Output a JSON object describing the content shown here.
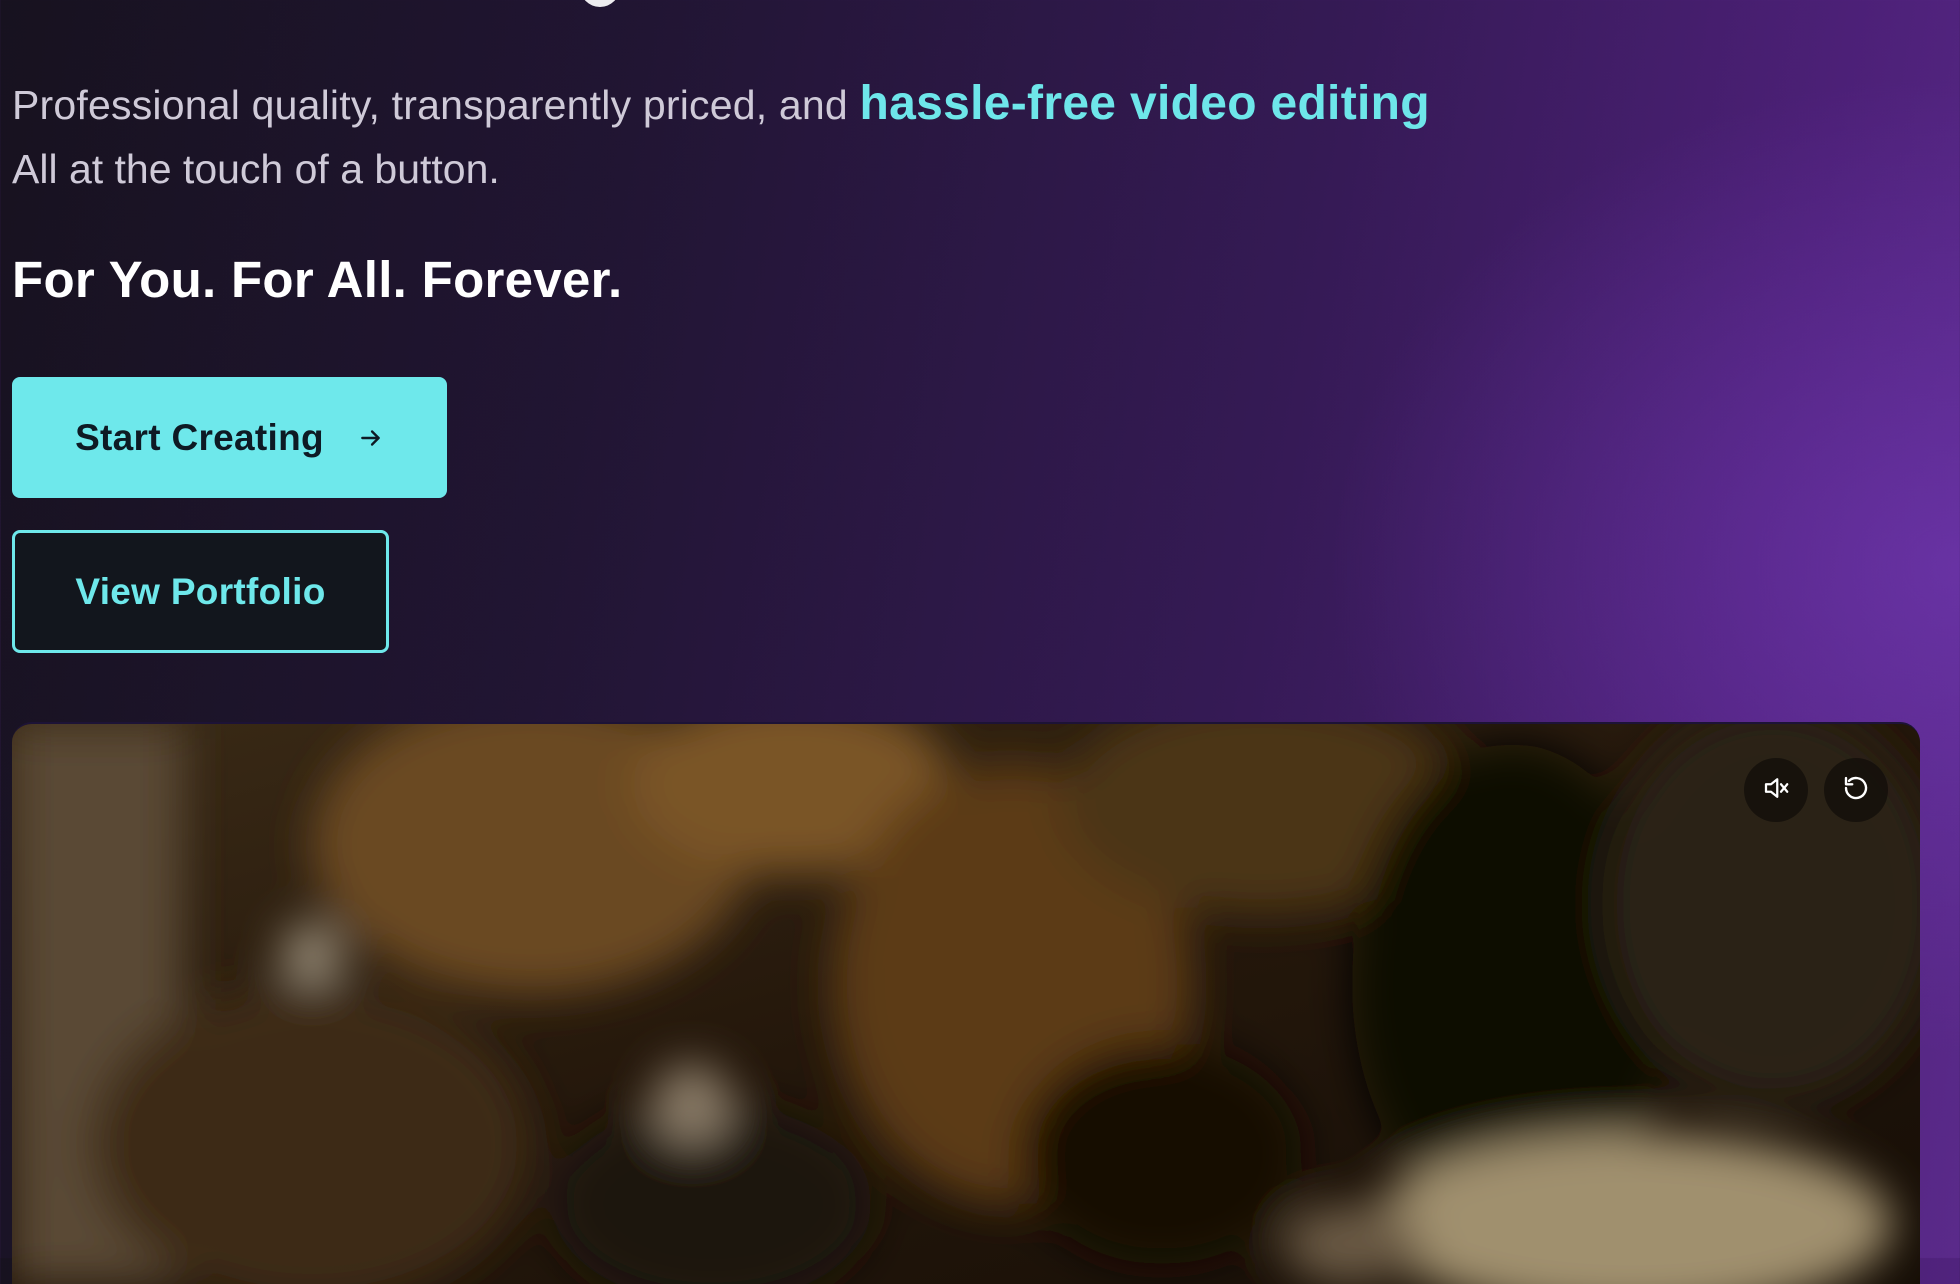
{
  "hero": {
    "tagline_prefix": "Professional quality, transparently priced, and ",
    "tagline_highlight": "hassle-free video editing",
    "tagline_line2": "All at the touch of a button.",
    "slogan": "For You. For All. Forever."
  },
  "actions": {
    "primary_label": "Start Creating",
    "primary_icon": "arrow-right-icon",
    "secondary_label": "View Portfolio"
  },
  "video": {
    "controls": [
      {
        "icon": "volume-muted-icon",
        "label": "Unmute"
      },
      {
        "icon": "replay-icon",
        "label": "Replay"
      }
    ]
  },
  "colors": {
    "accent": "#6ee8eb",
    "background_start": "#17121f",
    "background_end": "#5a2a8a",
    "secondary_button_bg": "#12161d"
  }
}
